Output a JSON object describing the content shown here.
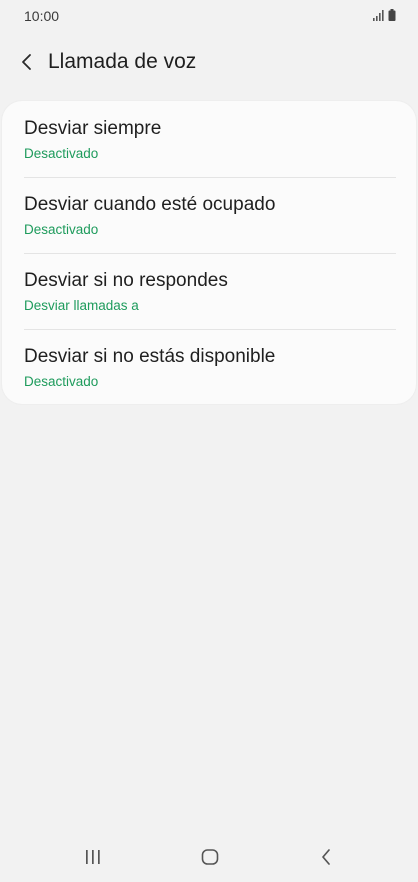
{
  "status_bar": {
    "time": "10:00",
    "icons": [
      "signal-icon",
      "battery-icon"
    ]
  },
  "header": {
    "back_icon": "chevron-left-icon",
    "title": "Llamada de voz"
  },
  "settings": {
    "items": [
      {
        "title": "Desviar siempre",
        "subtitle": "Desactivado"
      },
      {
        "title": "Desviar cuando esté ocupado",
        "subtitle": "Desactivado"
      },
      {
        "title": "Desviar si no respondes",
        "subtitle": "Desviar llamadas a"
      },
      {
        "title": "Desviar si no estás disponible",
        "subtitle": "Desactivado"
      }
    ]
  },
  "nav_bar": {
    "icons": [
      "recents-icon",
      "home-icon",
      "back-icon"
    ]
  },
  "colors": {
    "background": "#f2f2f2",
    "card": "#fbfbfb",
    "accent_green": "#1e9b5c",
    "text": "#1f1f1f"
  }
}
